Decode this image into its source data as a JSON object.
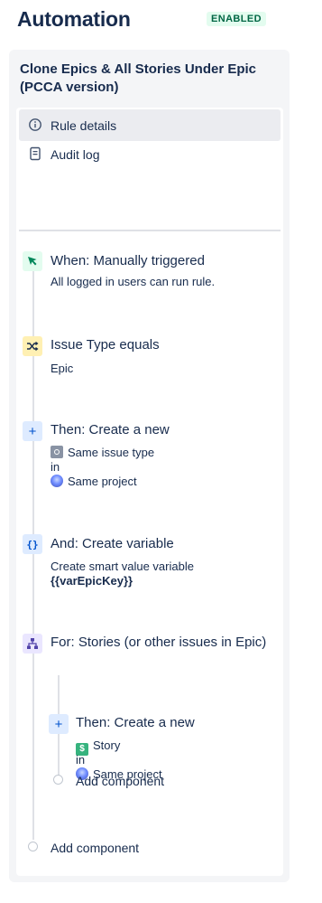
{
  "header": {
    "title": "Automation",
    "status_badge": "ENABLED"
  },
  "rule": {
    "title": "Clone Epics & All Stories Under Epic (PCCA version)"
  },
  "menu": {
    "items": [
      {
        "label": "Rule details",
        "icon": "info-icon",
        "active": true
      },
      {
        "label": "Audit log",
        "icon": "document-icon",
        "active": false
      }
    ]
  },
  "components": {
    "trigger": {
      "title": "When: Manually triggered",
      "description": "All logged in users can run rule.",
      "icon": "manual-trigger-icon"
    },
    "condition": {
      "title": "Issue Type equals",
      "description": "Epic",
      "icon": "shuffle-icon"
    },
    "action_create": {
      "title": "Then: Create a new",
      "issue_type": "Same issue type",
      "in": "in",
      "project": "Same project",
      "icon": "plus-icon"
    },
    "action_variable": {
      "title": "And: Create variable",
      "description": "Create smart value variable",
      "variable": "{{varEpicKey}}",
      "icon": "braces-icon",
      "icon_text": "{}"
    },
    "branch": {
      "title": "For: Stories (or other issues in Epic)",
      "icon": "branch-icon"
    },
    "branch_action": {
      "title": "Then: Create a new",
      "issue_type": "Story",
      "in": "in",
      "project": "Same project",
      "icon": "plus-icon"
    },
    "branch_add": {
      "label": "Add component"
    },
    "root_add": {
      "label": "Add component"
    }
  },
  "colors": {
    "enabled_bg": "#e3fcef",
    "enabled_text": "#006644",
    "story_green": "#36b37e",
    "accent_blue": "#0052cc"
  }
}
